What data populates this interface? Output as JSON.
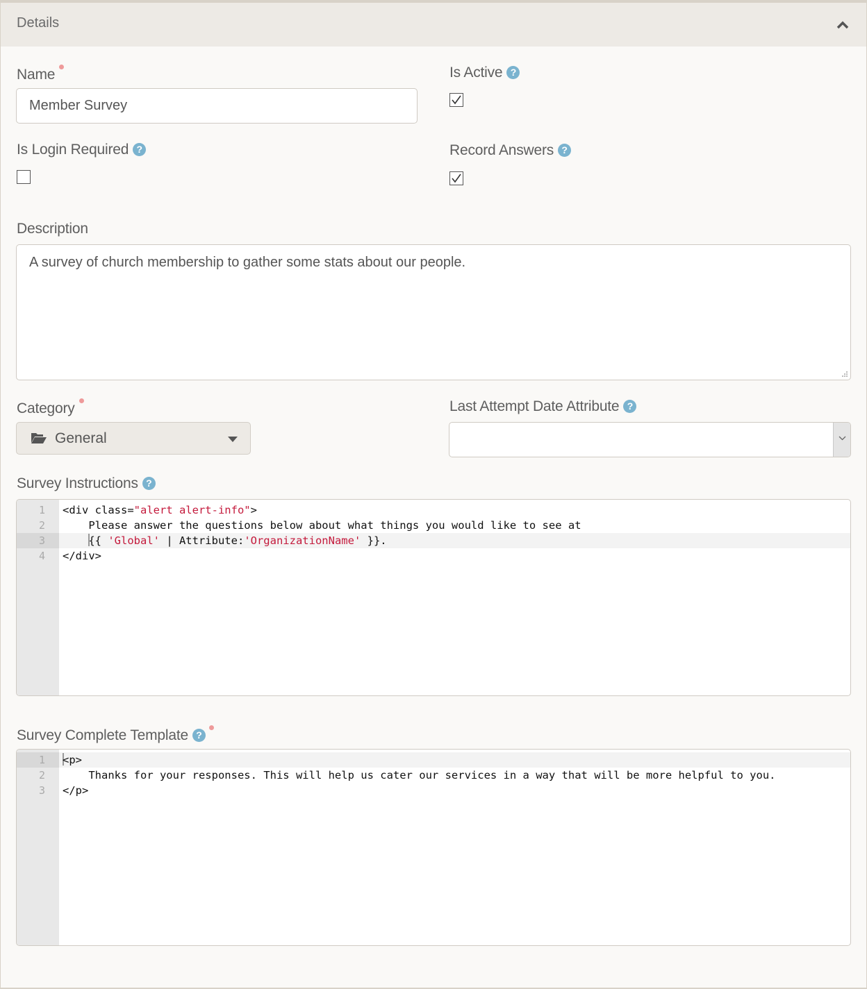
{
  "panel": {
    "title": "Details",
    "collapse_icon": "chevron-up-icon"
  },
  "fields": {
    "name": {
      "label": "Name",
      "required": true,
      "value": "Member Survey"
    },
    "is_active": {
      "label": "Is Active",
      "help": "?",
      "checked": true
    },
    "is_login_required": {
      "label": "Is Login Required",
      "help": "?",
      "checked": false
    },
    "record_answers": {
      "label": "Record Answers",
      "help": "?",
      "checked": true
    },
    "description": {
      "label": "Description",
      "value": "A survey of church membership to gather some stats about our people."
    },
    "category": {
      "label": "Category",
      "required": true,
      "value": "General",
      "icon": "folder-open-icon"
    },
    "last_attempt_date_attribute": {
      "label": "Last Attempt Date Attribute",
      "help": "?",
      "value": ""
    },
    "survey_instructions": {
      "label": "Survey Instructions",
      "help": "?",
      "active_line": 3,
      "lines": [
        {
          "num": "1",
          "parts": [
            {
              "t": "<div class=",
              "c": "tag"
            },
            {
              "t": "\"alert alert-info\"",
              "c": "str"
            },
            {
              "t": ">",
              "c": "tag"
            }
          ]
        },
        {
          "num": "2",
          "parts": [
            {
              "t": "    Please answer the questions below about what things you would like to see at",
              "c": "txt"
            }
          ]
        },
        {
          "num": "3",
          "parts": [
            {
              "t": "    {{ ",
              "c": "txt"
            },
            {
              "t": "'Global'",
              "c": "str"
            },
            {
              "t": " | Attribute:",
              "c": "txt"
            },
            {
              "t": "'OrganizationName'",
              "c": "str"
            },
            {
              "t": " }}.",
              "c": "txt"
            }
          ]
        },
        {
          "num": "4",
          "parts": [
            {
              "t": "</div>",
              "c": "tag"
            }
          ]
        }
      ]
    },
    "survey_complete_template": {
      "label": "Survey Complete Template",
      "help": "?",
      "required": true,
      "active_line": 1,
      "lines": [
        {
          "num": "1",
          "parts": [
            {
              "t": "<p>",
              "c": "tag"
            }
          ]
        },
        {
          "num": "2",
          "parts": [
            {
              "t": "    Thanks for your responses. This will help us cater our services in a way that will be more helpful to you.",
              "c": "txt"
            }
          ]
        },
        {
          "num": "3",
          "parts": [
            {
              "t": "</p>",
              "c": "tag"
            }
          ]
        }
      ]
    }
  },
  "colors": {
    "help_icon": "#7ab3cf",
    "required_dot": "#ee9a9a",
    "code_string": "#c41a3c",
    "header_bg": "#edeae5"
  }
}
